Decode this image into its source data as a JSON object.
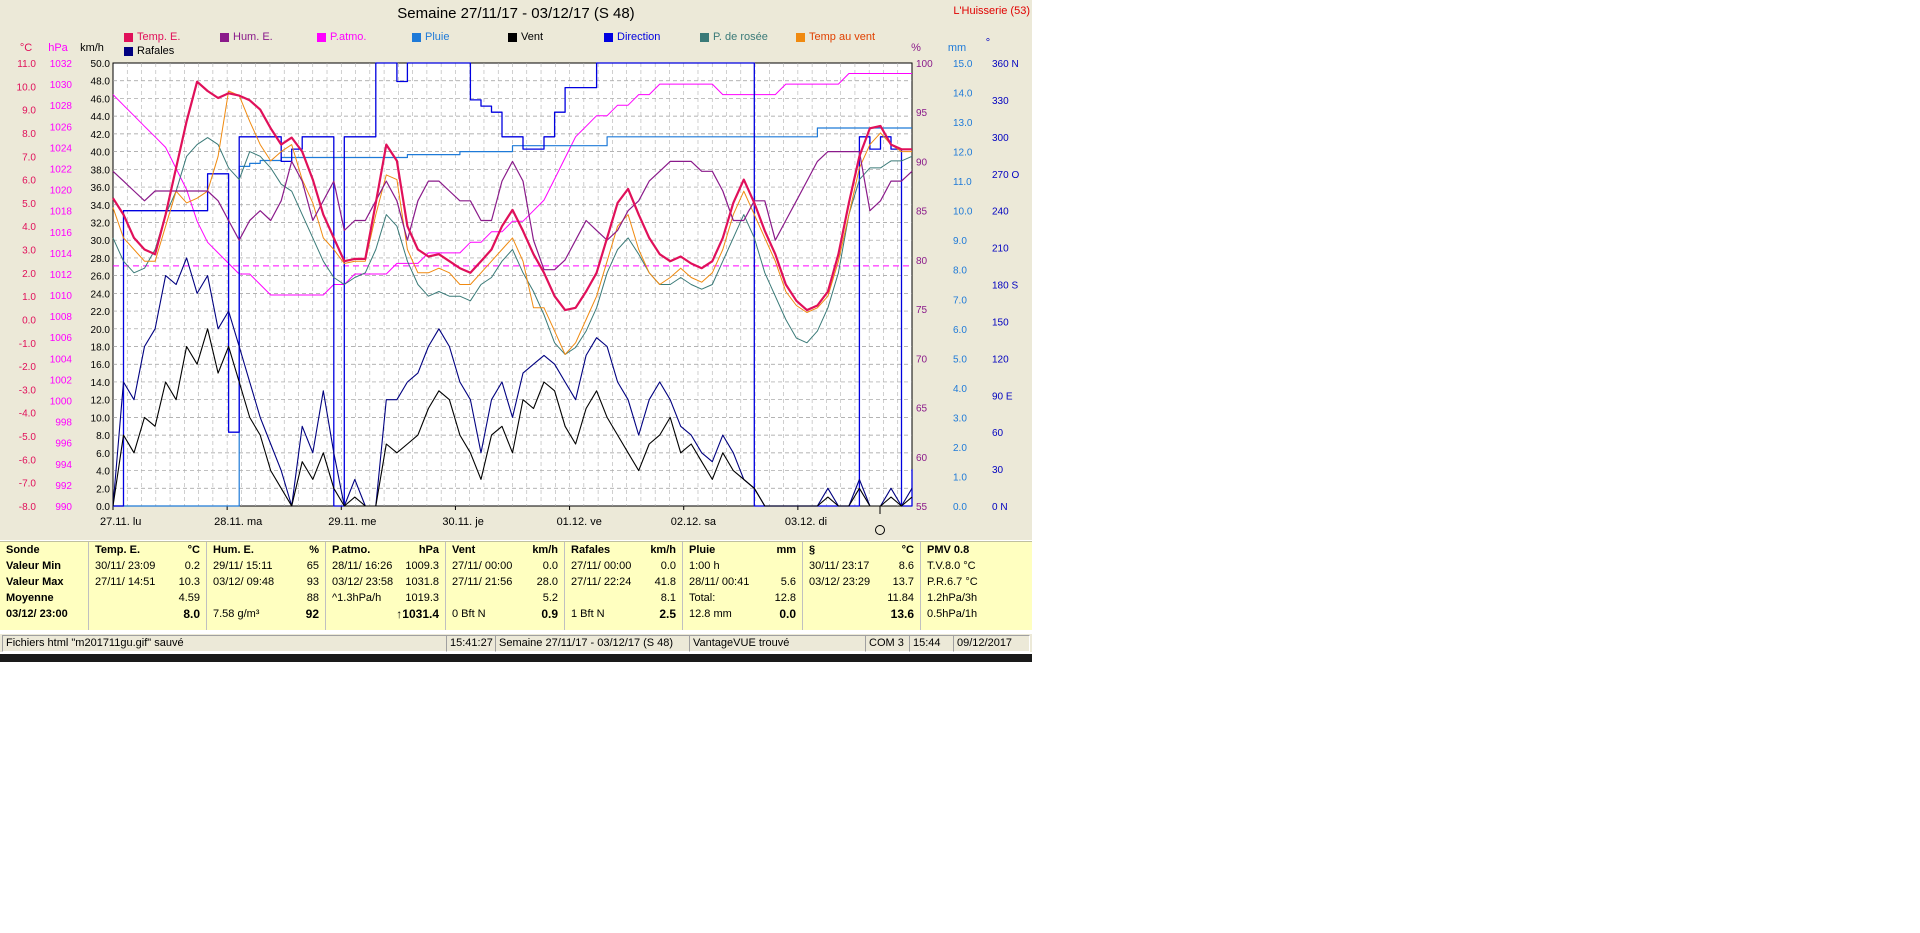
{
  "header": {
    "title": "Semaine 27/11/17 - 03/12/17 (S 48)",
    "station": "L'Huisserie (53)"
  },
  "legend": [
    {
      "label": "Temp. E.",
      "color": "#e0105a"
    },
    {
      "label": "Hum. E.",
      "color": "#8a1a8a"
    },
    {
      "label": "P.atmo.",
      "color": "#ff00ff"
    },
    {
      "label": "Pluie",
      "color": "#1e7ad8"
    },
    {
      "label": "Vent",
      "color": "#000000"
    },
    {
      "label": "Direction",
      "color": "#0000e0"
    },
    {
      "label": "P. de rosée",
      "color": "#3a7a78"
    },
    {
      "label": "Temp au vent",
      "color": "#f08a10"
    },
    {
      "label": "Rafales",
      "color": "#000080"
    }
  ],
  "chart_data": {
    "type": "line",
    "x_ticks": [
      "27.11. lu",
      "28.11. ma",
      "29.11. me",
      "30.11. je",
      "01.12. ve",
      "02.12. sa",
      "03.12. di"
    ],
    "unit_labels": {
      "temp": "°C",
      "pressure": "hPa",
      "wind": "km/h",
      "humidity": "%",
      "rain": "mm",
      "direction": "°"
    },
    "axes": {
      "temp": {
        "min": -8.0,
        "max": 11.0,
        "ticks": [
          "11.0",
          "10.0",
          "9.0",
          "8.0",
          "7.0",
          "6.0",
          "5.0",
          "4.0",
          "3.0",
          "2.0",
          "1.0",
          "0.0",
          "-1.0",
          "-2.0",
          "-3.0",
          "-4.0",
          "-5.0",
          "-6.0",
          "-7.0",
          "-8.0"
        ]
      },
      "pressure": {
        "min": 990,
        "max": 1032,
        "ticks": [
          "1032",
          "1030",
          "1028",
          "1026",
          "1024",
          "1022",
          "1020",
          "1018",
          "1016",
          "1014",
          "1012",
          "1010",
          "1008",
          "1006",
          "1004",
          "1002",
          "1000",
          "998",
          "996",
          "994",
          "992",
          "990"
        ]
      },
      "wind": {
        "min": 0,
        "max": 50,
        "ticks": [
          "50.0",
          "48.0",
          "46.0",
          "44.0",
          "42.0",
          "40.0",
          "38.0",
          "36.0",
          "34.0",
          "32.0",
          "30.0",
          "28.0",
          "26.0",
          "24.0",
          "22.0",
          "20.0",
          "18.0",
          "16.0",
          "14.0",
          "12.0",
          "10.0",
          "8.0",
          "6.0",
          "4.0",
          "2.0",
          "0.0"
        ]
      },
      "humidity": {
        "min": 55,
        "max": 100,
        "ticks": [
          "100",
          "95",
          "90",
          "85",
          "80",
          "75",
          "70",
          "65",
          "60",
          "55"
        ]
      },
      "rain": {
        "min": 0,
        "max": 15,
        "ticks": [
          "15.0",
          "14.0",
          "13.0",
          "12.0",
          "11.0",
          "10.0",
          "9.0",
          "8.0",
          "7.0",
          "6.0",
          "5.0",
          "4.0",
          "3.0",
          "2.0",
          "1.0",
          "0.0"
        ]
      },
      "direction": {
        "min": 0,
        "max": 360,
        "ticks": [
          "360 N",
          "330",
          "300",
          "270 O",
          "240",
          "210",
          "180 S",
          "150",
          "120",
          "90 E",
          "60",
          "30",
          "0 N"
        ]
      }
    },
    "series": [
      {
        "name": "Temp. E.",
        "axis": "temp",
        "values": [
          5.2,
          4.5,
          3.5,
          3.0,
          2.8,
          4.5,
          6.5,
          8.5,
          10.2,
          9.8,
          9.5,
          9.7,
          9.6,
          9.4,
          9.0,
          8.2,
          7.5,
          7.8,
          7.2,
          6.0,
          4.5,
          3.5,
          2.5,
          2.6,
          2.6,
          5.0,
          7.5,
          6.8,
          4.0,
          3.0,
          2.7,
          2.8,
          2.5,
          2.2,
          2.0,
          2.5,
          3.0,
          4.0,
          4.7,
          3.8,
          2.8,
          2.0,
          1.0,
          0.4,
          0.5,
          1.2,
          2.0,
          3.5,
          5.0,
          5.6,
          4.5,
          3.5,
          2.8,
          2.5,
          2.7,
          2.4,
          2.2,
          2.5,
          3.5,
          5.0,
          6.0,
          5.0,
          3.8,
          2.8,
          1.5,
          0.8,
          0.4,
          0.6,
          1.2,
          2.8,
          5.0,
          7.0,
          8.2,
          8.3,
          7.5,
          7.3,
          7.3
        ]
      },
      {
        "name": "Hum. E.",
        "axis": "humidity",
        "values": [
          89,
          88,
          87,
          86,
          87,
          87,
          87,
          87,
          87,
          87,
          86,
          84,
          82,
          84,
          85,
          84,
          86,
          90,
          88,
          84,
          86,
          88,
          83,
          84,
          84,
          86,
          88,
          86,
          82,
          86,
          88,
          88,
          87,
          86,
          86,
          84,
          84,
          88,
          90,
          88,
          82,
          79,
          79,
          80,
          82,
          84,
          83,
          82,
          83,
          85,
          86,
          88,
          89,
          90,
          90,
          90,
          89,
          89,
          87,
          84,
          84,
          86,
          86,
          82,
          84,
          86,
          88,
          90,
          91,
          91,
          91,
          91,
          85,
          86,
          88,
          88,
          89
        ]
      },
      {
        "name": "P.atmo.",
        "axis": "pressure",
        "values": [
          1029,
          1028,
          1027,
          1026,
          1025,
          1024,
          1022,
          1020,
          1017,
          1015,
          1014,
          1013,
          1012,
          1012,
          1011,
          1010,
          1010,
          1010,
          1010,
          1010,
          1010,
          1011,
          1011,
          1012,
          1012,
          1012,
          1012,
          1013,
          1013,
          1013,
          1014,
          1014,
          1014,
          1014,
          1015,
          1015,
          1016,
          1016,
          1017,
          1017,
          1018,
          1019,
          1021,
          1023,
          1025,
          1026,
          1027,
          1027,
          1028,
          1028,
          1029,
          1029,
          1030,
          1030,
          1030,
          1030,
          1030,
          1030,
          1029,
          1029,
          1029,
          1029,
          1029,
          1029,
          1030,
          1030,
          1030,
          1030,
          1030,
          1030,
          1031,
          1031,
          1031,
          1031,
          1031,
          1031,
          1031
        ]
      },
      {
        "name": "Pluie",
        "axis": "rain",
        "values": [
          0,
          0,
          0,
          0,
          0,
          0,
          0,
          0,
          0,
          0,
          0,
          0,
          11.5,
          11.6,
          11.7,
          11.7,
          11.8,
          11.8,
          11.8,
          11.8,
          11.8,
          11.8,
          11.8,
          11.8,
          11.8,
          11.8,
          11.8,
          11.8,
          11.9,
          11.9,
          11.9,
          11.9,
          11.9,
          12.0,
          12.0,
          12.0,
          12.0,
          12.0,
          12.2,
          12.2,
          12.2,
          12.2,
          12.2,
          12.2,
          12.2,
          12.2,
          12.2,
          12.5,
          12.5,
          12.5,
          12.5,
          12.5,
          12.5,
          12.5,
          12.5,
          12.5,
          12.5,
          12.5,
          12.5,
          12.5,
          12.5,
          12.5,
          12.5,
          12.5,
          12.5,
          12.5,
          12.5,
          12.8,
          12.8,
          12.8,
          12.8,
          12.8,
          12.8,
          12.8,
          12.8,
          12.8,
          12.8
        ]
      },
      {
        "name": "Vent",
        "axis": "wind",
        "values": [
          0,
          8,
          6,
          10,
          9,
          14,
          12,
          18,
          16,
          20,
          15,
          18,
          14,
          10,
          8,
          4,
          2,
          0,
          5,
          3,
          6,
          2,
          0,
          1,
          0,
          0,
          7,
          6,
          7,
          8,
          11,
          13,
          12,
          8,
          6,
          3,
          8,
          9,
          6,
          12,
          11,
          14,
          13,
          9,
          7,
          11,
          13,
          10,
          8,
          6,
          4,
          7,
          8,
          10,
          6,
          7,
          5,
          3,
          6,
          4,
          3,
          2,
          0,
          0,
          0,
          0,
          0,
          0,
          1,
          0,
          0,
          2,
          0,
          0,
          1,
          0,
          1
        ]
      },
      {
        "name": "Rafales",
        "axis": "wind",
        "values": [
          0,
          14,
          12,
          18,
          20,
          26,
          25,
          28,
          24,
          26,
          20,
          22,
          18,
          14,
          10,
          7,
          4,
          0,
          9,
          6,
          13,
          6,
          0,
          3,
          0,
          0,
          12,
          12,
          14,
          15,
          18,
          20,
          18,
          14,
          12,
          6,
          12,
          14,
          10,
          15,
          16,
          17,
          16,
          14,
          12,
          17,
          19,
          18,
          14,
          12,
          8,
          12,
          14,
          12,
          9,
          8,
          6,
          5,
          8,
          6,
          3,
          2,
          0,
          0,
          0,
          0,
          0,
          0,
          2,
          0,
          0,
          3,
          0,
          0,
          2,
          0,
          2
        ]
      },
      {
        "name": "Direction",
        "axis": "direction",
        "values": [
          0,
          240,
          240,
          240,
          240,
          240,
          240,
          240,
          240,
          270,
          270,
          60,
          300,
          300,
          300,
          300,
          280,
          290,
          300,
          300,
          300,
          0,
          300,
          300,
          300,
          360,
          360,
          345,
          360,
          360,
          360,
          360,
          360,
          360,
          330,
          325,
          320,
          300,
          300,
          290,
          290,
          300,
          320,
          340,
          340,
          340,
          360,
          360,
          360,
          360,
          360,
          360,
          360,
          360,
          360,
          360,
          360,
          360,
          360,
          360,
          360,
          0,
          0,
          0,
          0,
          0,
          0,
          0,
          0,
          0,
          0,
          300,
          290,
          300,
          290,
          0,
          30
        ]
      },
      {
        "name": "P. de rosée",
        "axis": "temp",
        "values": [
          3.5,
          2.5,
          2.0,
          2.2,
          3.0,
          4.5,
          5.5,
          7.0,
          7.5,
          7.8,
          7.5,
          6.5,
          6.0,
          7.2,
          7.0,
          6.5,
          5.8,
          5.5,
          4.5,
          3.5,
          2.5,
          1.8,
          1.5,
          1.8,
          2.0,
          3.0,
          4.5,
          4.0,
          2.5,
          1.5,
          1.0,
          1.2,
          1.0,
          1.0,
          0.8,
          1.5,
          1.8,
          2.5,
          3.0,
          2.0,
          1.2,
          0.2,
          -1.0,
          -1.5,
          -1.2,
          -0.5,
          0.5,
          2.0,
          3.0,
          3.5,
          2.8,
          2.0,
          1.5,
          1.5,
          1.8,
          1.5,
          1.3,
          1.5,
          2.5,
          3.5,
          4.5,
          3.5,
          2.0,
          1.0,
          0.0,
          -0.8,
          -1.0,
          -0.5,
          0.5,
          2.0,
          4.5,
          6.0,
          6.5,
          6.5,
          6.8,
          6.8,
          7.0
        ]
      },
      {
        "name": "Temp au vent",
        "axis": "temp",
        "values": [
          4.8,
          3.5,
          3.0,
          2.5,
          2.5,
          4.0,
          5.5,
          5.0,
          5.2,
          5.5,
          7.0,
          9.8,
          9.6,
          8.5,
          7.5,
          6.8,
          7.2,
          7.5,
          6.0,
          5.0,
          3.5,
          3.0,
          2.4,
          2.5,
          2.5,
          4.5,
          6.2,
          6.0,
          3.0,
          2.0,
          2.0,
          2.2,
          2.0,
          1.5,
          1.5,
          2.0,
          2.5,
          3.0,
          3.5,
          2.5,
          0.5,
          0.5,
          -0.5,
          -1.5,
          -1.0,
          0.0,
          1.0,
          2.5,
          4.0,
          4.5,
          3.0,
          2.0,
          1.5,
          1.8,
          2.2,
          1.8,
          1.6,
          2.0,
          3.0,
          4.5,
          5.5,
          4.5,
          3.5,
          2.5,
          1.2,
          0.6,
          0.3,
          0.5,
          1.0,
          2.5,
          4.5,
          6.5,
          7.5,
          8.0,
          7.5,
          7.2,
          7.2
        ]
      }
    ],
    "reference_line": {
      "axis": "temp",
      "value": 2.3,
      "color": "#ff00ff"
    }
  },
  "stats": {
    "sonde": {
      "header": "Sonde",
      "min": "Valeur Min",
      "max": "Valeur Max",
      "avg": "Moyenne",
      "last": "03/12/ 23:00"
    },
    "temp": {
      "header": "Temp. E.",
      "unit": "°C",
      "min_date": "30/11/ 23:09",
      "min_val": "0.2",
      "max_date": "27/11/ 14:51",
      "max_val": "10.3",
      "avg": "4.59",
      "last": "8.0"
    },
    "hum": {
      "header": "Hum. E.",
      "unit": "%",
      "min_date": "29/11/ 15:11",
      "min_val": "65",
      "max_date": "03/12/ 09:48",
      "max_val": "93",
      "avg": "88",
      "extra": "7.58 g/m³",
      "last": "92"
    },
    "patmo": {
      "header": "P.atmo.",
      "unit": "hPa",
      "min_date": "28/11/ 16:26",
      "min_val": "1009.3",
      "max_date": "03/12/ 23:58",
      "max_val": "1031.8",
      "trend": "^1.3hPa/h",
      "avg": "1019.3",
      "last": "↑1031.4"
    },
    "vent": {
      "header": "Vent",
      "unit": "km/h",
      "min_date": "27/11/ 00:00",
      "min_val": "0.0",
      "max_date": "27/11/ 21:56",
      "max_val": "28.0",
      "avg": "5.2",
      "extra": "0 Bft N",
      "last": "0.9"
    },
    "rafales": {
      "header": "Rafales",
      "unit": "km/h",
      "min_date": "27/11/ 00:00",
      "min_val": "0.0",
      "max_date": "27/11/ 22:24",
      "max_val": "41.8",
      "avg": "8.1",
      "extra": "1 Bft N",
      "last": "2.5"
    },
    "pluie": {
      "header": "Pluie",
      "unit": "mm",
      "r1_label": "1:00 h",
      "r2_label": "28/11/ 00:41",
      "r2_val": "5.6",
      "r3_label": "Total:",
      "r3_val": "12.8",
      "r4_label": "12.8 mm",
      "last": "0.0"
    },
    "s": {
      "header": "§",
      "unit": "°C",
      "min_date": "30/11/ 23:17",
      "min_val": "8.6",
      "max_date": "03/12/ 23:29",
      "max_val": "13.7",
      "avg": "11.84",
      "last": "13.6"
    },
    "pmv": {
      "header": "PMV 0.8",
      "l1": "T.V.8.0 °C",
      "l2": "P.R.6.7 °C",
      "l3": "1.2hPa/3h",
      "l4": "0.5hPa/1h"
    }
  },
  "statusbar": {
    "file": "Fichiers html  \"m201711gu.gif\"  sauvé",
    "time1": "15:41:27",
    "period": "Semaine 27/11/17 - 03/12/17 (S 48)",
    "device": "VantageVUE trouvé",
    "com": "COM 3",
    "time2": "15:44",
    "date": "09/12/2017"
  }
}
